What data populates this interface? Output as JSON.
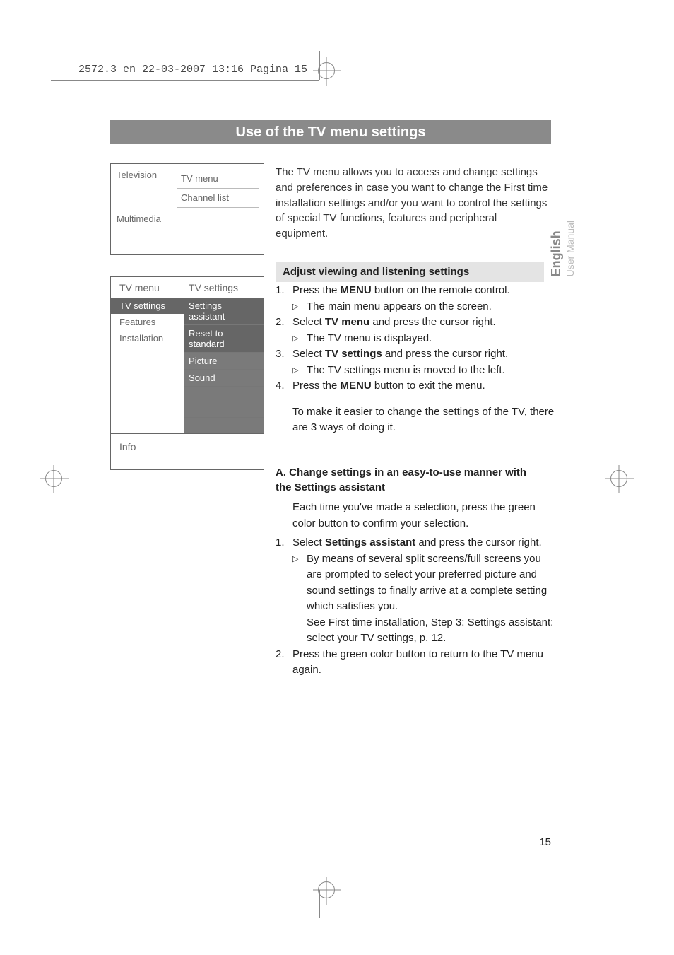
{
  "header": "2572.3 en  22-03-2007  13:16  Pagina 15",
  "title_bar": "Use of the TV menu settings",
  "menu1": {
    "left": [
      "Television",
      "Multimedia"
    ],
    "right": [
      "TV menu",
      "Channel list"
    ]
  },
  "menu2": {
    "left_header": "TV menu",
    "left_items": [
      "TV settings",
      "Features",
      "Installation"
    ],
    "right_header": "TV settings",
    "right_items": [
      "Settings assistant",
      "Reset to standard",
      "Picture",
      "Sound"
    ],
    "info": "Info"
  },
  "intro": "The TV menu allows you to access and change settings and preferences in case you want to change the First time installation settings and/or you want to control the settings of special TV functions, features and peripheral equipment.",
  "section1_hdr": "Adjust viewing and listening settings",
  "steps1": {
    "s1a": "Press the ",
    "s1b": "MENU",
    "s1c": " button on the remote control.",
    "s1sub": "The main menu appears on the screen.",
    "s2a": "Select ",
    "s2b": "TV menu",
    "s2c": " and press the cursor right.",
    "s2sub": "The TV menu is displayed.",
    "s3a": "Select ",
    "s3b": "TV settings",
    "s3c": " and press the cursor right.",
    "s3sub": "The TV settings menu is moved to the left.",
    "s4a": "Press the ",
    "s4b": "MENU",
    "s4c": " button to exit the menu.",
    "note": "To make it easier to change the settings of the TV, there are 3 ways of doing it."
  },
  "sectionA_hdr": "A. Change settings in an easy-to-use manner with the Settings assistant",
  "sectionA_intro": "Each time you've made a selection, press the green color button to confirm your selection.",
  "stepsA": {
    "s1a": "Select ",
    "s1b": "Settings assistant",
    "s1c": " and press the cursor right.",
    "s1sub1": "By means of several split screens/full screens you are prompted to select your preferred picture and sound settings to finally arrive at a complete setting which satisfies you.",
    "s1sub2": "See First time installation, Step 3: Settings assistant: select your TV settings, p. 12.",
    "s2": "Press the green color button to return to the TV menu again."
  },
  "side": {
    "main": "English",
    "sub": "User Manual"
  },
  "page": "15"
}
